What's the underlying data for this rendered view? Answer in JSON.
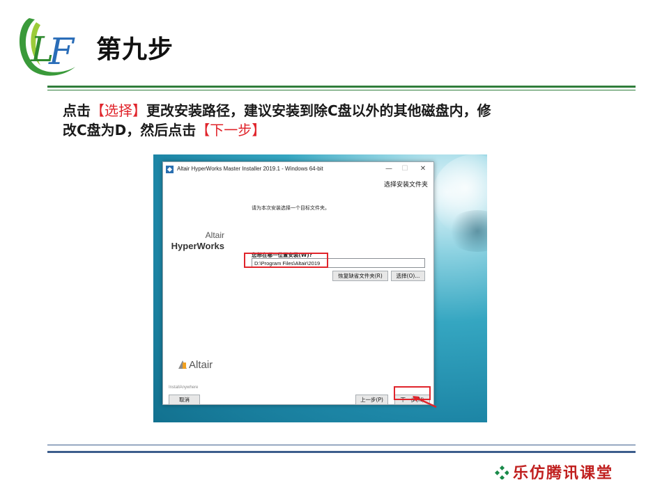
{
  "header": {
    "logo_text": "LF",
    "title": "第九步"
  },
  "instruction": {
    "line1_a": "点击",
    "line1_hl": "【选择】",
    "line1_b": "更改安装路径，建议安装到除C盘以外的其他磁盘内，修",
    "line2_a": "改C盘为D，然后点击",
    "line2_hl": "【下一步】"
  },
  "installer": {
    "window_title": "Altair HyperWorks Master Installer 2019.1 - Windows 64-bit",
    "section_title": "选择安装文件夹",
    "brand_line1": "Altair",
    "brand_line2": "HyperWorks",
    "prompt": "请为本次安装选择一个目标文件夹。",
    "question": "您想在哪一位置安装(W)?",
    "path_value": "D:\\Program Files\\Altair\\2019",
    "restore_button": "恢复缺省文件夹(R)",
    "choose_button": "选择(O)...",
    "altair_logo_text": "Altair",
    "installanywhere": "InstallAnywhere",
    "cancel_button": "取消",
    "prev_button": "上一步(P)",
    "next_button": "下一步(N)",
    "window_controls": {
      "min": "—",
      "max": "☐",
      "close": "✕"
    }
  },
  "footer": {
    "brand": "乐仿腾讯课堂"
  },
  "colors": {
    "accent_red": "#e0242b",
    "rule_green": "#2f7d3b",
    "rule_blue": "#3c5d8c",
    "brand_red": "#c0201f"
  }
}
